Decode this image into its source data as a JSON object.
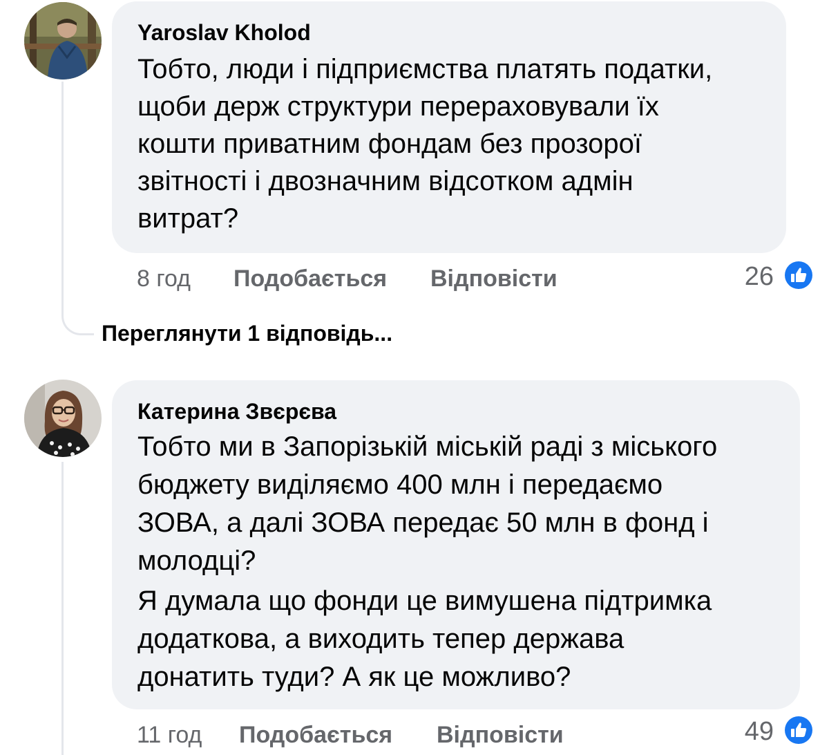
{
  "comments": [
    {
      "author": "Yaroslav Kholod",
      "text_lines": [
        "Тобто, люди і підприємства платять податки,",
        "щоби держ структури перераховували їх",
        "кошти приватним фондам без прозорої",
        "звітності і двозначним відсотком адмін",
        "витрат?"
      ],
      "time": "8 год",
      "like_label": "Подобається",
      "reply_label": "Відповісти",
      "reaction_count": "26",
      "reaction_icon": "like-icon",
      "view_replies": "Переглянути 1 відповідь..."
    },
    {
      "author": "Катерина Звєрєва",
      "text_lines": [
        "Тобто ми в Запорізькій міській раді з міського",
        "бюджету виділяємо 400 млн і передаємо",
        "ЗОВА, а далі ЗОВА передає 50 млн в фонд і",
        "молодці?",
        "Я думала що фонди це вимушена підтримка",
        "додаткова, а виходить тепер держава",
        "донатить туди? А як це можливо?"
      ],
      "time": "11 год",
      "like_label": "Подобається",
      "reply_label": "Відповісти",
      "reaction_count": "49",
      "reaction_icon": "like-icon"
    }
  ],
  "colors": {
    "bubble": "#f0f2f5",
    "text": "#050505",
    "meta": "#65676b",
    "like_blue": "#1877f2",
    "thread_line": "#e4e6eb"
  }
}
